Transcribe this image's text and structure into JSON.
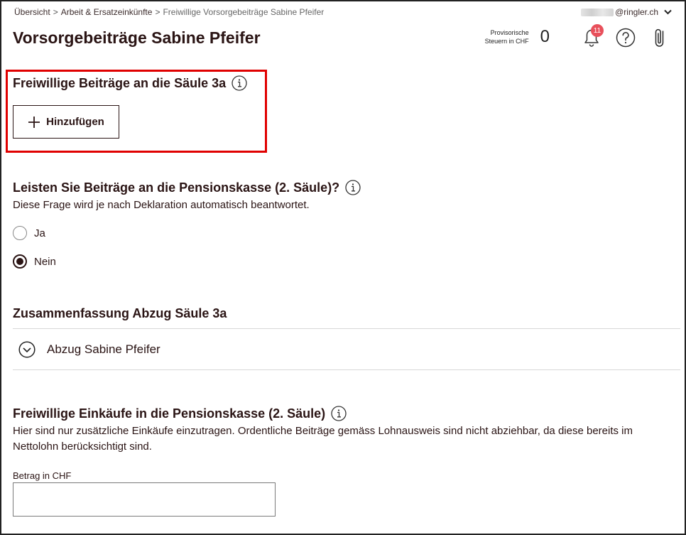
{
  "breadcrumb": {
    "items": [
      "Übersicht",
      "Arbeit & Ersatzeinkünfte"
    ],
    "separator": ">",
    "current": "Freiwillige Vorsorgebeiträge Sabine Pfeifer"
  },
  "account": {
    "email_domain": "@ringler.ch"
  },
  "page": {
    "title": "Vorsorgebeiträge Sabine Pfeifer"
  },
  "header": {
    "tax_label_line1": "Provisorische",
    "tax_label_line2": "Steuern in CHF",
    "tax_value": "0",
    "notification_count": "11"
  },
  "section_3a": {
    "title": "Freiwillige Beiträge an die Säule 3a",
    "add_label": "Hinzufügen"
  },
  "section_pk": {
    "title": "Leisten Sie Beiträge an die Pensionskasse (2. Säule)?",
    "hint": "Diese Frage wird je nach Deklaration automatisch beantwortet.",
    "options": [
      {
        "label": "Ja",
        "checked": false
      },
      {
        "label": "Nein",
        "checked": true
      }
    ]
  },
  "summary": {
    "title": "Zusammenfassung Abzug Säule 3a",
    "item_label": "Abzug Sabine Pfeifer"
  },
  "purchases": {
    "title": "Freiwillige Einkäufe in die Pensionskasse (2. Säule)",
    "description": "Hier sind nur zusätzliche Einkäufe einzutragen. Ordentliche Beiträge gemäss Lohnausweis sind nicht abziehbar, da diese bereits im Nettolohn berücksichtigt sind.",
    "field_label": "Betrag in CHF",
    "field_value": ""
  },
  "colors": {
    "highlight": "#e00000",
    "badge": "#e8505b",
    "text": "#2a1414"
  },
  "icons": [
    "info-icon",
    "plus-icon",
    "bell-icon",
    "help-icon",
    "paperclip-icon",
    "chevron-down-icon",
    "chevron-down-circle-icon"
  ]
}
